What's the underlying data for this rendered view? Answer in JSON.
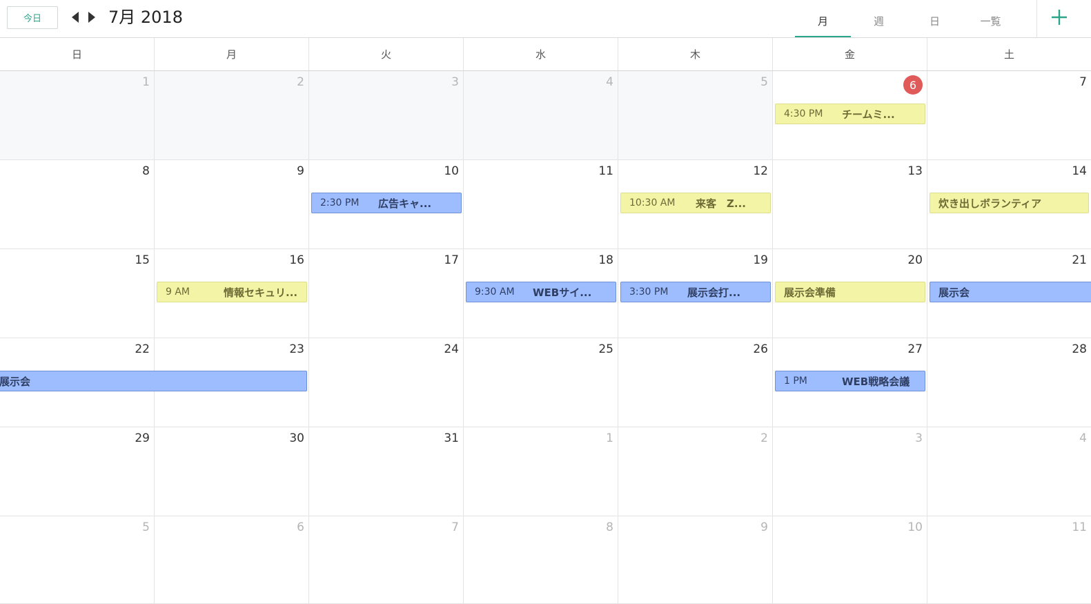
{
  "header": {
    "today_label": "今日",
    "month_title": "7月 2018",
    "views": [
      {
        "label": "月",
        "active": true
      },
      {
        "label": "週",
        "active": false
      },
      {
        "label": "日",
        "active": false
      },
      {
        "label": "一覧",
        "active": false
      }
    ],
    "add_icon": "plus-icon"
  },
  "weekdays": [
    "日",
    "月",
    "火",
    "水",
    "木",
    "金",
    "土"
  ],
  "weeks": [
    [
      {
        "d": "1",
        "dim": true,
        "other": true
      },
      {
        "d": "2",
        "dim": true,
        "other": true
      },
      {
        "d": "3",
        "dim": true,
        "other": true
      },
      {
        "d": "4",
        "dim": true,
        "other": true
      },
      {
        "d": "5",
        "dim": true,
        "other": true
      },
      {
        "d": "6",
        "today": true
      },
      {
        "d": "7"
      }
    ],
    [
      {
        "d": "8"
      },
      {
        "d": "9"
      },
      {
        "d": "10"
      },
      {
        "d": "11"
      },
      {
        "d": "12"
      },
      {
        "d": "13"
      },
      {
        "d": "14"
      }
    ],
    [
      {
        "d": "15"
      },
      {
        "d": "16"
      },
      {
        "d": "17"
      },
      {
        "d": "18"
      },
      {
        "d": "19"
      },
      {
        "d": "20"
      },
      {
        "d": "21"
      }
    ],
    [
      {
        "d": "22"
      },
      {
        "d": "23"
      },
      {
        "d": "24"
      },
      {
        "d": "25"
      },
      {
        "d": "26"
      },
      {
        "d": "27"
      },
      {
        "d": "28"
      }
    ],
    [
      {
        "d": "29"
      },
      {
        "d": "30"
      },
      {
        "d": "31"
      },
      {
        "d": "1",
        "dim": true
      },
      {
        "d": "2",
        "dim": true
      },
      {
        "d": "3",
        "dim": true
      },
      {
        "d": "4",
        "dim": true
      }
    ],
    [
      {
        "d": "5",
        "dim": true
      },
      {
        "d": "6",
        "dim": true
      },
      {
        "d": "7",
        "dim": true
      },
      {
        "d": "8",
        "dim": true
      },
      {
        "d": "9",
        "dim": true
      },
      {
        "d": "10",
        "dim": true
      },
      {
        "d": "11",
        "dim": true
      }
    ]
  ],
  "events": [
    {
      "week": 0,
      "day": 5,
      "span": 1,
      "color": "yellow",
      "time": "4:30 PM",
      "title": "チームミ..."
    },
    {
      "week": 1,
      "day": 2,
      "span": 1,
      "color": "blue",
      "time": "2:30 PM",
      "title": "広告キャ..."
    },
    {
      "week": 1,
      "day": 4,
      "span": 1,
      "color": "yellow",
      "time": "10:30 AM",
      "title": "来客　Z..."
    },
    {
      "week": 1,
      "day": 6,
      "span": 1,
      "color": "yellow",
      "time": "",
      "title": "炊き出しボランティア"
    },
    {
      "week": 2,
      "day": 1,
      "span": 1,
      "color": "yellow",
      "time": "9 AM",
      "title": "情報セキュリ..."
    },
    {
      "week": 2,
      "day": 3,
      "span": 1,
      "color": "blue",
      "time": "9:30 AM",
      "title": "WEBサイ..."
    },
    {
      "week": 2,
      "day": 4,
      "span": 1,
      "color": "blue",
      "time": "3:30 PM",
      "title": "展示会打..."
    },
    {
      "week": 2,
      "day": 5,
      "span": 1,
      "color": "yellow",
      "time": "",
      "title": "展示会準備"
    },
    {
      "week": 2,
      "day": 6,
      "span": 1,
      "color": "blue",
      "time": "",
      "title": "展示会",
      "continues": true
    },
    {
      "week": 3,
      "day": 0,
      "span": 2,
      "color": "blue",
      "time": "",
      "title": "展示会",
      "continued": true
    },
    {
      "week": 3,
      "day": 5,
      "span": 1,
      "color": "blue",
      "time": "1 PM",
      "title": "WEB戦略会議"
    }
  ]
}
